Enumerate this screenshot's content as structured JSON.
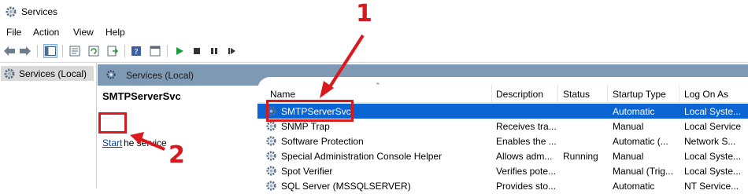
{
  "window": {
    "title": "Services"
  },
  "menu": [
    "File",
    "Action",
    "View",
    "Help"
  ],
  "tree": {
    "root_label": "Services (Local)"
  },
  "panel": {
    "header": "Services (Local)"
  },
  "extended": {
    "service_name": "SMTPServerSvc",
    "start_link": "Start",
    "start_suffix": "he service"
  },
  "table": {
    "columns": [
      "Name",
      "Description",
      "Status",
      "Startup Type",
      "Log On As"
    ],
    "rows": [
      {
        "name": "SMTPServerSvc",
        "description": "",
        "status": "",
        "startup": "Automatic",
        "logon": "Local Syste...",
        "selected": true
      },
      {
        "name": "SNMP Trap",
        "description": "Receives tra...",
        "status": "",
        "startup": "Manual",
        "logon": "Local Service"
      },
      {
        "name": "Software Protection",
        "description": "Enables the ...",
        "status": "",
        "startup": "Automatic (...",
        "logon": "Network S..."
      },
      {
        "name": "Special Administration Console Helper",
        "description": "Allows adm...",
        "status": "Running",
        "startup": "Manual",
        "logon": "Local Syste..."
      },
      {
        "name": "Spot Verifier",
        "description": "Verifies pote...",
        "status": "",
        "startup": "Manual (Trig...",
        "logon": "Local Syste..."
      },
      {
        "name": "SQL Server (MSSQLSERVER)",
        "description": "Provides sto...",
        "status": "",
        "startup": "Automatic",
        "logon": "NT Service..."
      }
    ]
  },
  "annotations": {
    "label1": "1",
    "label2": "2"
  },
  "colors": {
    "selection": "#0a64d2",
    "annotation": "#d9191e",
    "header_bar": "#7e99b4",
    "link": "#0645ad"
  },
  "icons": {
    "toolbar": [
      "back-arrow-icon",
      "forward-arrow-icon",
      "show-hide-tree-icon",
      "properties-icon",
      "refresh-icon",
      "export-list-icon",
      "help-icon",
      "console-icon",
      "play-icon",
      "stop-icon",
      "pause-icon",
      "restart-icon"
    ],
    "service": "gear-icon"
  }
}
